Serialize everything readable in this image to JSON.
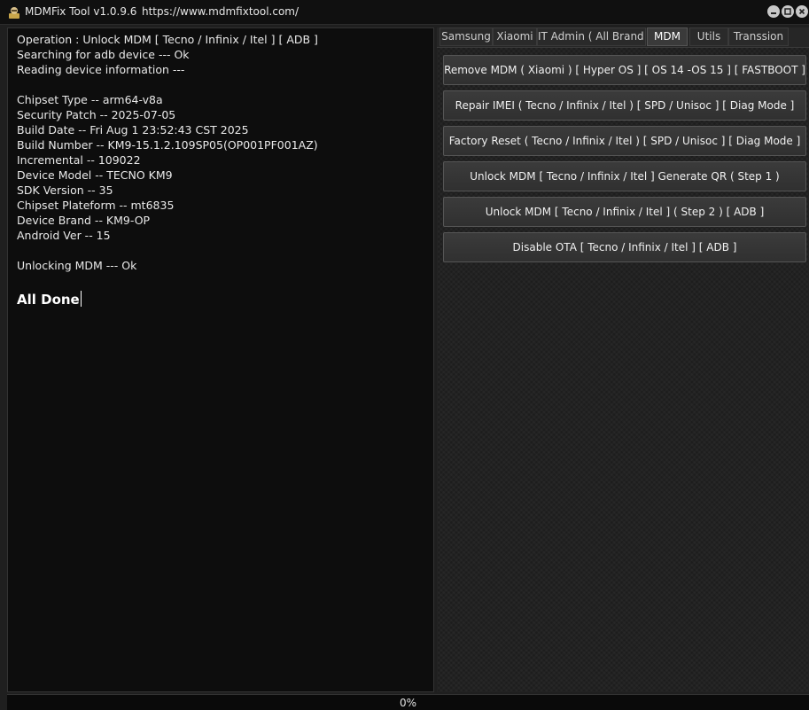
{
  "window": {
    "title": "MDMFix Tool v1.0.9.6",
    "url": "https://www.mdmfixtool.com/"
  },
  "log": {
    "lines": [
      "Operation : Unlock MDM [ Tecno / Infinix / Itel ] [ ADB ]",
      "Searching for adb device --- Ok",
      "Reading device information ---",
      "",
      "Chipset Type -- arm64-v8a",
      "Security Patch -- 2025-07-05",
      "Build Date -- Fri Aug  1 23:52:43 CST 2025",
      "Build Number -- KM9-15.1.2.109SP05(OP001PF001AZ)",
      "Incremental -- 109022",
      "Device Model -- TECNO KM9",
      "SDK Version -- 35",
      "Chipset Plateform -- mt6835",
      "Device Brand -- KM9-OP",
      "Android Ver -- 15",
      "",
      "Unlocking MDM --- Ok"
    ],
    "done": "All Done"
  },
  "tabs": [
    {
      "label": "Samsung",
      "active": false
    },
    {
      "label": "Xiaomi",
      "active": false
    },
    {
      "label": "IT Admin ( All Brand )",
      "active": false
    },
    {
      "label": "MDM",
      "active": true
    },
    {
      "label": "Utils",
      "active": false
    },
    {
      "label": "Transsion",
      "active": false
    }
  ],
  "mdm_buttons": [
    "Remove MDM ( Xiaomi ) [ Hyper OS ] [ OS 14 -OS 15 ] [ FASTBOOT ]",
    "Repair IMEI ( Tecno / Infinix / Itel ) [ SPD / Unisoc ] [ Diag Mode ]",
    "Factory Reset ( Tecno / Infinix / Itel ) [ SPD / Unisoc ] [ Diag Mode ]",
    "Unlock MDM [ Tecno / Infinix / Itel ] Generate QR ( Step 1 )",
    "Unlock MDM [ Tecno / Infinix / Itel ] ( Step 2 ) [ ADB ]",
    "Disable OTA [ Tecno / Infinix / Itel ] [ ADB ]"
  ],
  "status": {
    "progress_percent": 0,
    "progress_label": "0%"
  },
  "icons": {
    "app": "app-logo-icon",
    "minimize": "minimize-icon",
    "maximize": "maximize-icon",
    "close": "close-icon"
  }
}
